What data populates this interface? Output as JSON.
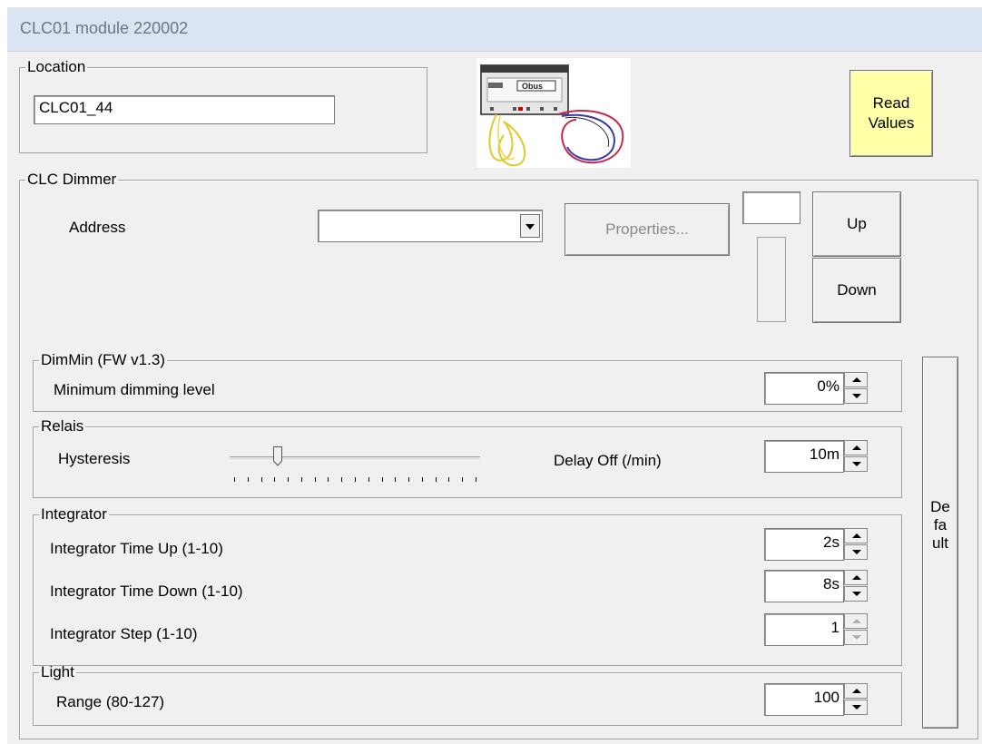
{
  "window": {
    "title": "CLC01 module 220002"
  },
  "location": {
    "legend": "Location",
    "value": "CLC01_44"
  },
  "device_image": {
    "brand": "Obus"
  },
  "read_values_button": {
    "label": "Read\nValues",
    "bg": "#ffffa8"
  },
  "dimmer": {
    "legend": "CLC Dimmer",
    "address_label": "Address",
    "address_value": "",
    "properties_label": "Properties...",
    "value_box": "",
    "up_label": "Up",
    "down_label": "Down",
    "level": 0
  },
  "dimmin": {
    "legend": "DimMin (FW v1.3)",
    "min_label": "Minimum dimming level",
    "min_value": "0%"
  },
  "relais": {
    "legend": "Relais",
    "hysteresis_label": "Hysteresis",
    "hysteresis_level": 0.18,
    "delay_label": "Delay Off (/min)",
    "delay_value": "10m"
  },
  "integrator": {
    "legend": "Integrator",
    "rows": [
      {
        "label": "Integrator Time Up (1-10)",
        "value": "2s"
      },
      {
        "label": "Integrator Time Down (1-10)",
        "value": "8s"
      },
      {
        "label": "Integrator Step (1-10)",
        "value": "1"
      }
    ]
  },
  "light": {
    "legend": "Light",
    "range_label": "Range (80-127)",
    "range_value": "100"
  },
  "default_button": {
    "label": "Default"
  }
}
